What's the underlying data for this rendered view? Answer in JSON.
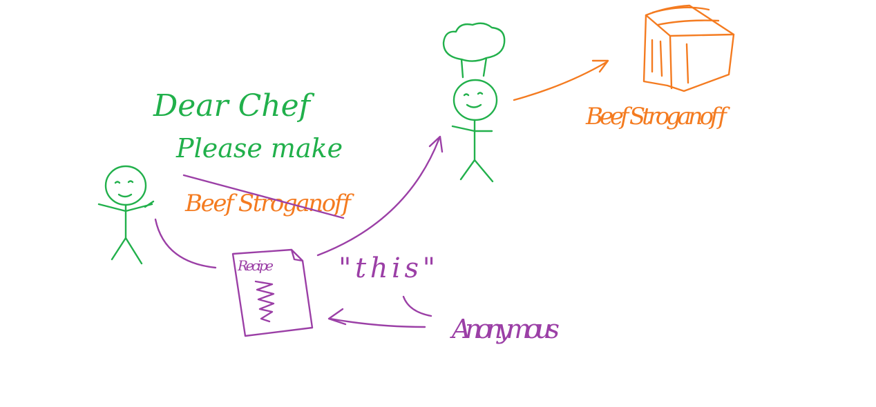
{
  "colors": {
    "background": "#ffffff",
    "green": "#21b04b",
    "orange": "#f47b20",
    "purple": "#9b3fa6"
  },
  "note": {
    "line1": "Dear Chef",
    "line2": "Please make",
    "line3": "Beef Stroganoff",
    "line3_struck": true
  },
  "recipe": {
    "label": "Recipe"
  },
  "pointer": {
    "label": "\"this\""
  },
  "anonymous": {
    "label": "Anonymous"
  },
  "dish": {
    "label": "Beef Stroganoff"
  },
  "figures": {
    "customer": "stick-figure",
    "chef": "stick-figure-with-chef-hat",
    "dish_icon": "casserole-box-icon"
  }
}
